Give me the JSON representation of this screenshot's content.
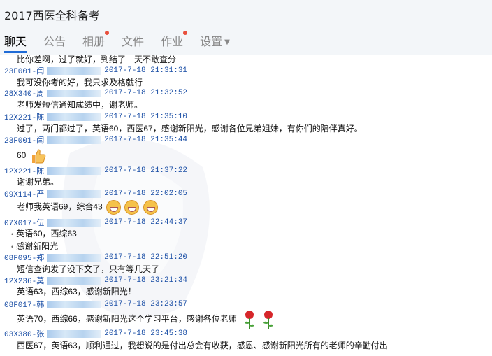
{
  "app": {
    "title": "2017西医全科备考"
  },
  "tabs": [
    {
      "label": "聊天",
      "active": true,
      "dot": false
    },
    {
      "label": "公告",
      "active": false,
      "dot": false
    },
    {
      "label": "相册",
      "active": false,
      "dot": true
    },
    {
      "label": "文件",
      "active": false,
      "dot": false
    },
    {
      "label": "作业",
      "active": false,
      "dot": true
    },
    {
      "label": "设置",
      "active": false,
      "dot": false,
      "dropdown": true
    }
  ],
  "messages": [
    {
      "text": "比你差啊，过了就好，到结了一天不敢查分"
    },
    {
      "sender": "23F001-闫",
      "time": "2017-7-18 21:31:31",
      "lines": [
        "我可没你考的好，我只求及格就行"
      ]
    },
    {
      "sender": "28X340-周",
      "time": "2017-7-18 21:32:52",
      "lines": [
        "老师发短信通知成绩中，谢老师。"
      ]
    },
    {
      "sender": "12X221-陈",
      "time": "2017-7-18 21:35:10",
      "lines": [
        "过了，两门都过了，英语60，西医67，感谢新阳光，感谢各位兄弟姐妹，有你们的陪伴真好。"
      ]
    },
    {
      "sender": "23F001-闫",
      "time": "2017-7-18 21:35:44",
      "lines": [
        "60"
      ],
      "emoji": "thumbs-up"
    },
    {
      "sender": "12X221-陈",
      "time": "2017-7-18 21:37:22",
      "lines": [
        "谢谢兄弟。"
      ]
    },
    {
      "sender": "09X114-严",
      "time": "2017-7-18 22:02:05",
      "lines": [
        "老师我英语69，综合43"
      ],
      "emoji": "laugh-cry"
    },
    {
      "sender": "07X017-伍",
      "time": "2017-7-18 22:44:37",
      "bullets": [
        "英语60，西综63",
        "感谢新阳光"
      ]
    },
    {
      "sender": "08F095-郑",
      "time": "2017-7-18 22:51:20",
      "lines": [
        "短信查询发了没下文了，只有等几天了"
      ]
    },
    {
      "sender": "12X236-莫",
      "time": "2017-7-18 23:21:34",
      "lines": [
        "英语63，西综63，感谢新阳光！"
      ]
    },
    {
      "sender": "08F017-韩",
      "time": "2017-7-18 23:23:57",
      "lines": [
        "英语70，西综66，感谢新阳光这个学习平台，感谢各位老师"
      ],
      "emoji": "rose"
    },
    {
      "sender": "03X380-张",
      "time": "2017-7-18 23:45:38",
      "lines": [
        "西医67，英语63，顺利通过，我想说的是付出总会有收获，感恩、感谢新阳光所有的老师的辛勤付出"
      ]
    }
  ]
}
